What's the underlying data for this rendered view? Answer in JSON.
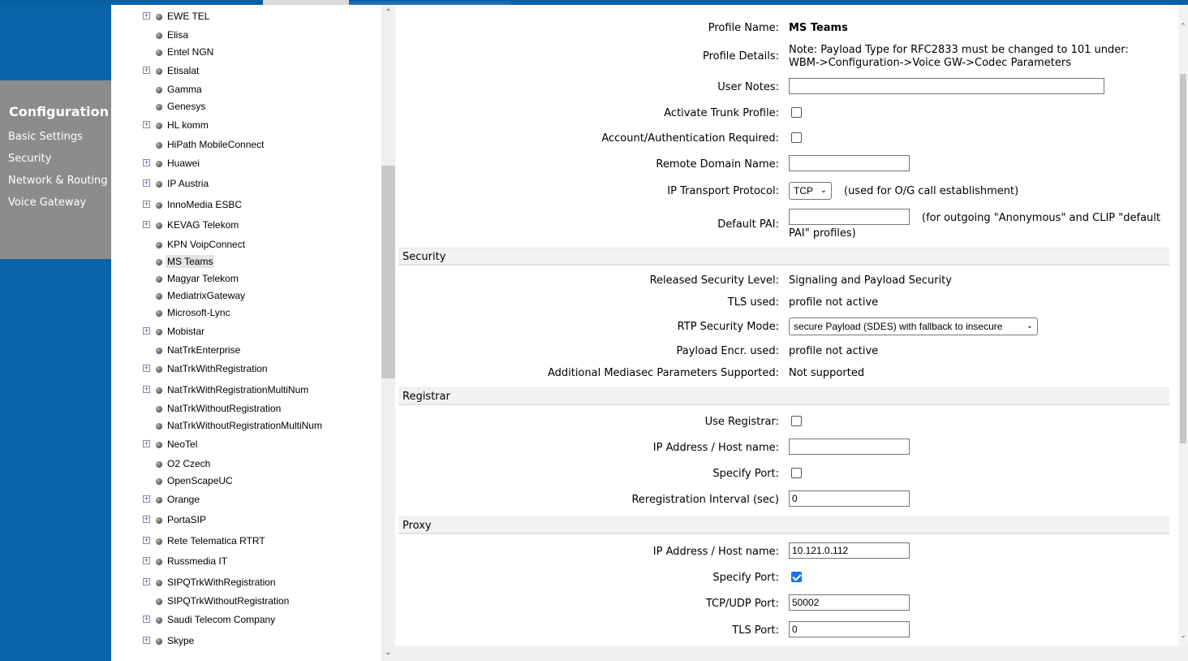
{
  "nav": {
    "title": "Configuration",
    "items": [
      "Basic Settings",
      "Security",
      "Network & Routing",
      "Voice Gateway"
    ]
  },
  "tree": [
    {
      "label": "EWE TEL",
      "expandable": true
    },
    {
      "label": "Elisa",
      "expandable": false
    },
    {
      "label": "Entel NGN",
      "expandable": false
    },
    {
      "label": "Etisalat",
      "expandable": true
    },
    {
      "label": "Gamma",
      "expandable": false
    },
    {
      "label": "Genesys",
      "expandable": false
    },
    {
      "label": "HL komm",
      "expandable": true
    },
    {
      "label": "HiPath MobileConnect",
      "expandable": false
    },
    {
      "label": "Huawei",
      "expandable": true
    },
    {
      "label": "IP Austria",
      "expandable": true
    },
    {
      "label": "InnoMedia ESBC",
      "expandable": true
    },
    {
      "label": "KEVAG Telekom",
      "expandable": true
    },
    {
      "label": "KPN VoipConnect",
      "expandable": false
    },
    {
      "label": "MS Teams",
      "expandable": false,
      "selected": true
    },
    {
      "label": "Magyar Telekom",
      "expandable": false
    },
    {
      "label": "MediatrixGateway",
      "expandable": false
    },
    {
      "label": "Microsoft-Lync",
      "expandable": false
    },
    {
      "label": "Mobistar",
      "expandable": true
    },
    {
      "label": "NatTrkEnterprise",
      "expandable": false
    },
    {
      "label": "NatTrkWithRegistration",
      "expandable": true
    },
    {
      "label": "NatTrkWithRegistrationMultiNum",
      "expandable": true
    },
    {
      "label": "NatTrkWithoutRegistration",
      "expandable": false
    },
    {
      "label": "NatTrkWithoutRegistrationMultiNum",
      "expandable": false
    },
    {
      "label": "NeoTel",
      "expandable": true
    },
    {
      "label": "O2 Czech",
      "expandable": false
    },
    {
      "label": "OpenScapeUC",
      "expandable": false
    },
    {
      "label": "Orange",
      "expandable": true
    },
    {
      "label": "PortaSIP",
      "expandable": true
    },
    {
      "label": "Rete Telematica RTRT",
      "expandable": true
    },
    {
      "label": "Russmedia IT",
      "expandable": true
    },
    {
      "label": "SIPQTrkWithRegistration",
      "expandable": true
    },
    {
      "label": "SIPQTrkWithoutRegistration",
      "expandable": false
    },
    {
      "label": "Saudi Telecom Company",
      "expandable": true
    },
    {
      "label": "Skype",
      "expandable": true
    }
  ],
  "form": {
    "profile_name_label": "Profile Name:",
    "profile_name": "MS Teams",
    "profile_details_label": "Profile Details:",
    "profile_details_line1": "Note: Payload Type for RFC2833 must be changed to 101 under:",
    "profile_details_line2": "WBM->Configuration->Voice GW->Codec Parameters",
    "user_notes_label": "User Notes:",
    "user_notes_value": "",
    "activate_trunk_label": "Activate Trunk Profile:",
    "account_auth_label": "Account/Authentication Required:",
    "remote_domain_label": "Remote Domain Name:",
    "remote_domain_value": "",
    "ip_transport_label": "IP Transport Protocol:",
    "ip_transport_value": "TCP",
    "ip_transport_note": "(used for O/G call establishment)",
    "default_pai_label": "Default PAI:",
    "default_pai_value": "",
    "default_pai_note_line1": "(for outgoing \"Anonymous\" and CLIP \"default",
    "default_pai_note_line2": "PAI\" profiles)"
  },
  "security": {
    "header": "Security",
    "released_level_label": "Released Security Level:",
    "released_level_value": "Signaling and Payload Security",
    "tls_used_label": "TLS used:",
    "tls_used_value": "profile not active",
    "rtp_mode_label": "RTP Security Mode:",
    "rtp_mode_value": "secure Payload (SDES) with fallback to insecure",
    "payload_encr_label": "Payload Encr. used:",
    "payload_encr_value": "profile not active",
    "mediasec_label": "Additional Mediasec Parameters Supported:",
    "mediasec_value": "Not supported"
  },
  "registrar": {
    "header": "Registrar",
    "use_registrar_label": "Use Registrar:",
    "ip_host_label": "IP Address / Host name:",
    "ip_host_value": "",
    "specify_port_label": "Specify Port:",
    "rereg_label": "Reregistration Interval (sec)",
    "rereg_value": "0"
  },
  "proxy": {
    "header": "Proxy",
    "ip_host_label": "IP Address / Host name:",
    "ip_host_value": "10.121.0.112",
    "specify_port_label": "Specify Port:",
    "tcp_udp_port_label": "TCP/UDP Port:",
    "tcp_udp_port_value": "50002",
    "tls_port_label": "TLS Port:",
    "tls_port_value": "0"
  },
  "colors": {
    "nav_blue": "#0a64a8",
    "nav_gray": "#8c8c8c",
    "checkbox_checked": "#1a73e8"
  }
}
